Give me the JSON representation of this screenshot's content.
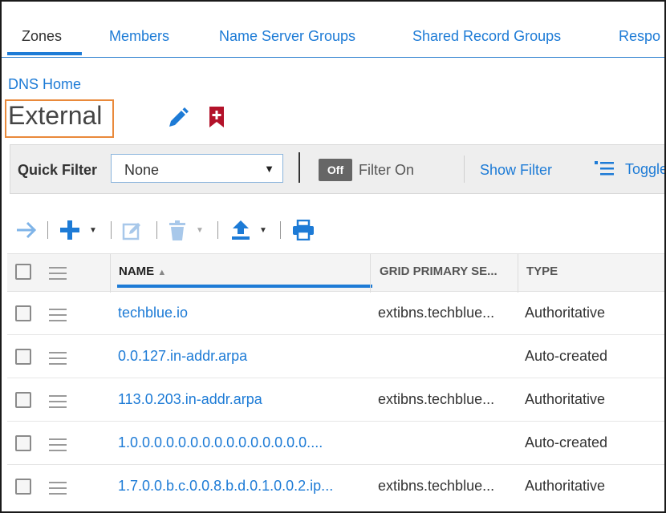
{
  "tabs": [
    {
      "label": "Zones"
    },
    {
      "label": "Members"
    },
    {
      "label": "Name Server Groups"
    },
    {
      "label": "Shared Record Groups"
    },
    {
      "label": "Respo"
    }
  ],
  "breadcrumb": "DNS Home",
  "page_title": "External",
  "filter": {
    "quick_filter_label": "Quick Filter",
    "quick_filter_value": "None",
    "toggle_state": "Off",
    "filter_on_label": "Filter On",
    "show_filter_label": "Show Filter",
    "toggle_label": "Toggle"
  },
  "table": {
    "columns": [
      "NAME",
      "GRID PRIMARY SE...",
      "TYPE"
    ],
    "rows": [
      {
        "name": "techblue.io",
        "grid": "extibns.techblue...",
        "type": "Authoritative"
      },
      {
        "name": "0.0.127.in-addr.arpa",
        "grid": "",
        "type": "Auto-created"
      },
      {
        "name": "113.0.203.in-addr.arpa",
        "grid": "extibns.techblue...",
        "type": "Authoritative"
      },
      {
        "name": "1.0.0.0.0.0.0.0.0.0.0.0.0.0.0.0....",
        "grid": "",
        "type": "Auto-created"
      },
      {
        "name": "1.7.0.0.b.c.0.0.8.b.d.0.1.0.0.2.ip...",
        "grid": "extibns.techblue...",
        "type": "Authoritative"
      }
    ]
  },
  "colors": {
    "accent": "#1d7bd6",
    "title_highlight": "#e9893a",
    "bookmark": "#b3122a",
    "toggle_off_bg": "#666666"
  }
}
